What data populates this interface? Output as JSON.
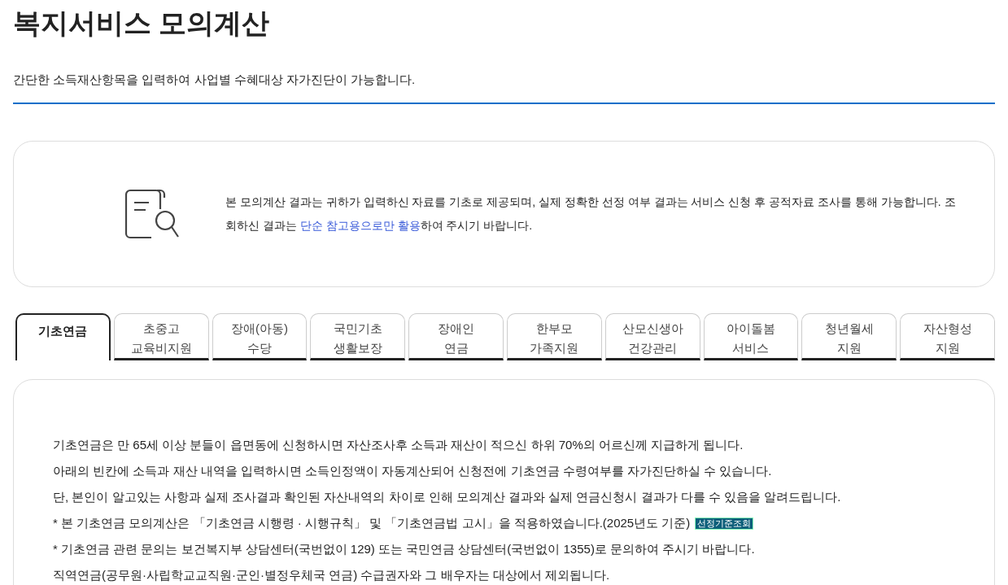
{
  "title": "복지서비스 모의계산",
  "subtitle": "간단한 소득재산항목을 입력하여 사업별 수혜대상 자가진단이 가능합니다.",
  "notice": {
    "parts": [
      {
        "text": "본 모의계산 결과는 귀하가 입력하신 자료를 기초로 제공되며, 실제 정확한 선정 여부 결과는 서비스 신청 후 공적자료 조사를 통해 가능합니다. 조회하신 결과는 ",
        "highlight": false
      },
      {
        "text": "단순 참고용으로만 활용",
        "highlight": true
      },
      {
        "text": "하여 주시기 바랍니다.",
        "highlight": false
      }
    ]
  },
  "tabs": [
    {
      "lines": [
        "기초연금"
      ],
      "selected": true
    },
    {
      "lines": [
        "초중고",
        "교육비지원"
      ],
      "selected": false
    },
    {
      "lines": [
        "장애(아동)",
        "수당"
      ],
      "selected": false
    },
    {
      "lines": [
        "국민기초",
        "생활보장"
      ],
      "selected": false
    },
    {
      "lines": [
        "장애인",
        "연금"
      ],
      "selected": false
    },
    {
      "lines": [
        "한부모",
        "가족지원"
      ],
      "selected": false
    },
    {
      "lines": [
        "산모신생아",
        "건강관리"
      ],
      "selected": false
    },
    {
      "lines": [
        "아이돌봄",
        "서비스"
      ],
      "selected": false
    },
    {
      "lines": [
        "청년월세",
        "지원"
      ],
      "selected": false
    },
    {
      "lines": [
        "자산형성",
        "지원"
      ],
      "selected": false
    }
  ],
  "content": [
    {
      "text": "기초연금은 만 65세 이상 분들이 읍면동에 신청하시면 자산조사후 소득과 재산이 적으신 하위 70%의 어르신께 지급하게 됩니다."
    },
    {
      "text": "아래의 빈칸에 소득과 재산 내역을 입력하시면 소득인정액이 자동계산되어 신청전에 기초연금 수령여부를 자가진단하실 수 있습니다."
    },
    {
      "text": "단, 본인이 알고있는 사항과 실제 조사결과 확인된 자산내역의 차이로 인해 모의계산 결과와 실제 연금신청시 결과가 다를 수 있음을 알려드립니다."
    },
    {
      "text": "* 본 기초연금 모의계산은 「기초연금 시행령 · 시행규칙」 및 「기초연금법 고시」을 적용하였습니다.(2025년도 기준)",
      "button": "선정기준조회"
    },
    {
      "text": "* 기초연금 관련 문의는 보건복지부 상담센터(국번없이 129) 또는 국민연금 상담센터(국번없이 1355)로 문의하여 주시기 바랍니다."
    },
    {
      "text": "직역연금(공무원·사립학교교직원·군인·별정우체국 연금) 수급권자와 그 배우자는 대상에서 제외됩니다."
    }
  ]
}
